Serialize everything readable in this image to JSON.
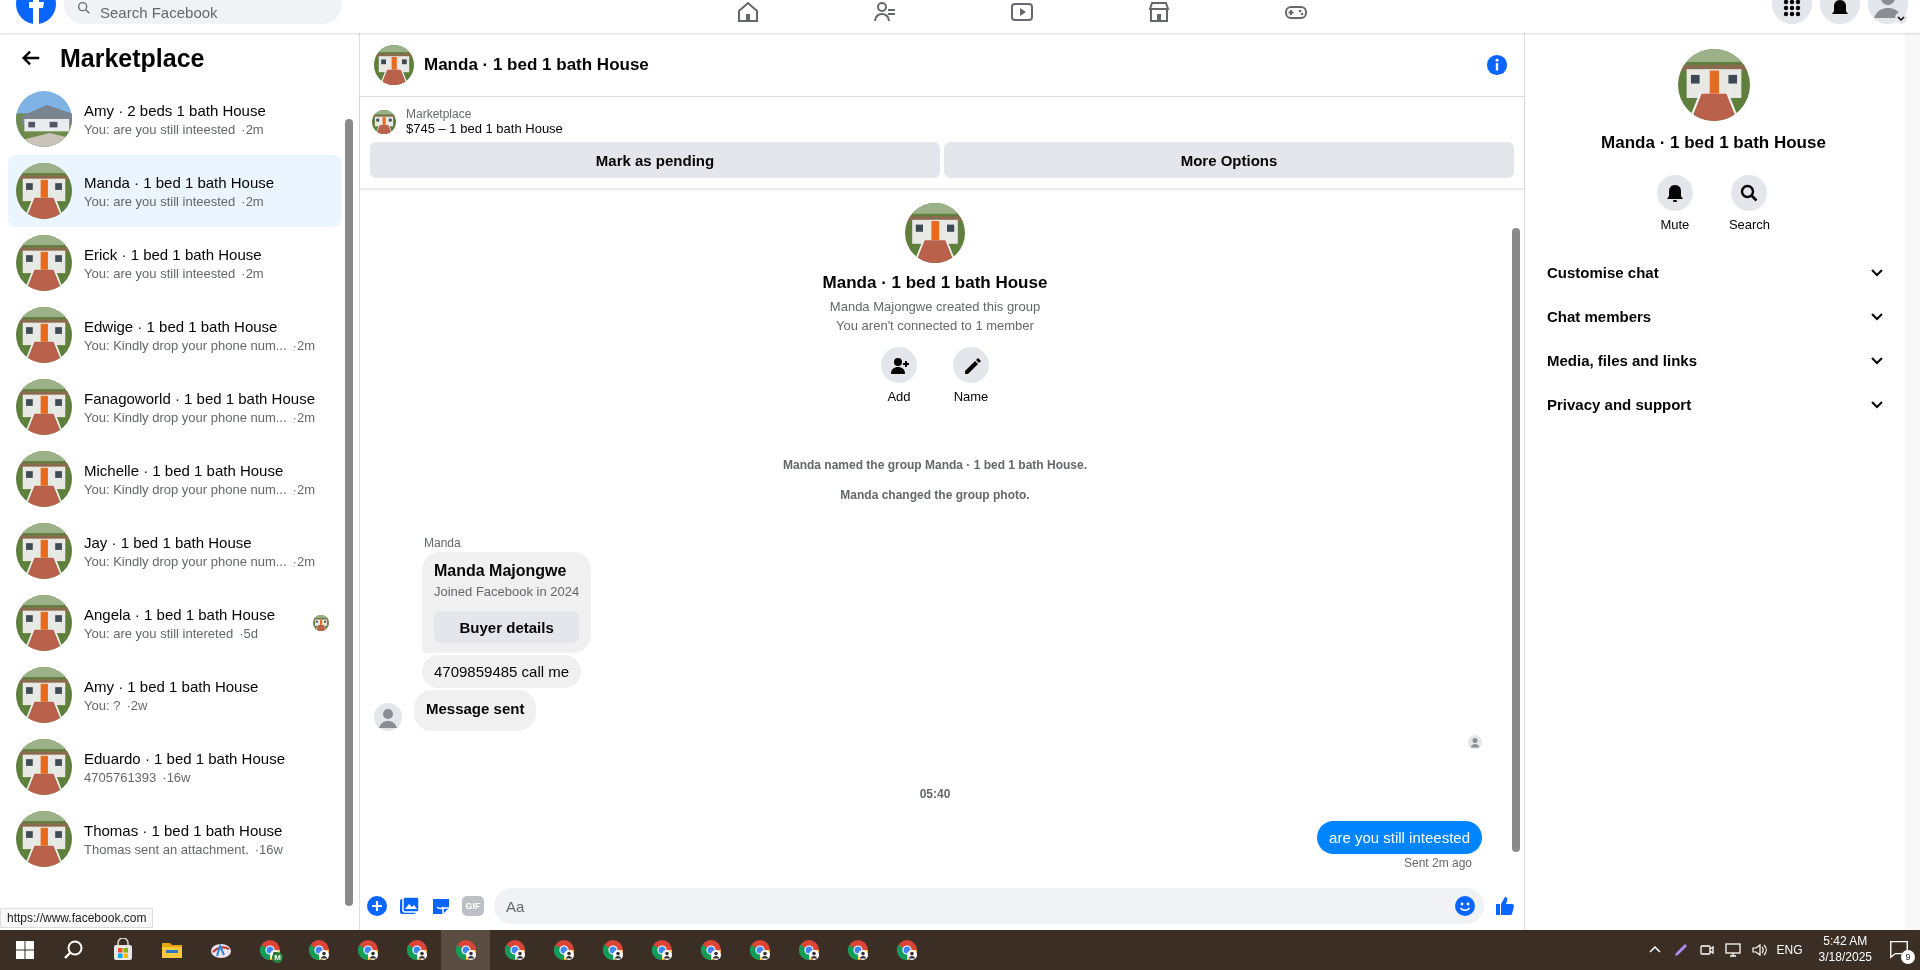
{
  "top_bar": {
    "search": {
      "placeholder": "Search Facebook"
    }
  },
  "sidebar": {
    "title": "Marketplace",
    "conversations": [
      {
        "title": "Amy · 2 beds 1 bath House",
        "preview": "You: are you still inteested",
        "time": "·2m",
        "selected": false,
        "seen": false
      },
      {
        "title": "Manda · 1 bed 1 bath House",
        "preview": "You: are you still inteested",
        "time": "·2m",
        "selected": true,
        "seen": false
      },
      {
        "title": "Erick · 1 bed 1 bath House",
        "preview": "You: are you still inteested",
        "time": "·2m",
        "selected": false,
        "seen": false
      },
      {
        "title": "Edwige · 1 bed 1 bath House",
        "preview": "You: Kindly drop your phone num...",
        "time": "·2m",
        "selected": false,
        "seen": false
      },
      {
        "title": "Fanagoworld · 1 bed 1 bath House",
        "preview": "You: Kindly drop your phone num...",
        "time": "·2m",
        "selected": false,
        "seen": false
      },
      {
        "title": "Michelle · 1 bed 1 bath House",
        "preview": "You: Kindly drop your phone num...",
        "time": "·2m",
        "selected": false,
        "seen": false
      },
      {
        "title": "Jay · 1 bed 1 bath House",
        "preview": "You: Kindly drop your phone num...",
        "time": "·2m",
        "selected": false,
        "seen": false
      },
      {
        "title": "Angela · 1 bed 1 bath House",
        "preview": "You: are you still intereted",
        "time": "·5d",
        "selected": false,
        "seen": true
      },
      {
        "title": "Amy · 1 bed 1 bath House",
        "preview": "You: ?",
        "time": "·2w",
        "selected": false,
        "seen": false
      },
      {
        "title": "Eduardo · 1 bed 1 bath House",
        "preview": "4705761393",
        "time": "·16w",
        "selected": false,
        "seen": false
      },
      {
        "title": "Thomas · 1 bed 1 bath House",
        "preview": "Thomas sent an attachment.",
        "time": "·16w",
        "selected": false,
        "seen": false
      }
    ]
  },
  "chat": {
    "title": "Manda · 1 bed 1 bath House",
    "listing": {
      "label": "Marketplace",
      "title": "$745 – 1 bed 1 bath House"
    },
    "actions": [
      "Mark as pending",
      "More Options"
    ],
    "intro": {
      "title": "Manda · 1 bed 1 bath House",
      "lines": [
        "Manda Majongwe created this group",
        "You aren't connected to 1 member"
      ],
      "buttons": [
        {
          "kind": "add",
          "label": "Add"
        },
        {
          "kind": "name",
          "label": "Name"
        }
      ]
    },
    "events": [
      "Manda named the group Manda · 1 bed 1 bath House.",
      "Manda changed the group photo."
    ],
    "sender": "Manda",
    "buyer_card": {
      "name": "Manda Majongwe",
      "subtitle": "Joined Facebook in 2024",
      "button": "Buyer details"
    },
    "messages": [
      {
        "text": "4709859485 call me",
        "bold": false
      },
      {
        "text": "Message sent",
        "bold": true
      }
    ],
    "timestamp": "05:40",
    "outgoing": {
      "text": "are you still inteested",
      "status": "Sent 2m ago"
    },
    "composer": {
      "gif_label": "GIF",
      "placeholder": "Aa"
    }
  },
  "details": {
    "title": "Manda · 1 bed 1 bath House",
    "actions": [
      {
        "kind": "mute",
        "label": "Mute"
      },
      {
        "kind": "search",
        "label": "Search"
      }
    ],
    "sections": [
      "Customise chat",
      "Chat members",
      "Media, files and links",
      "Privacy and support"
    ]
  },
  "status_url": "https://www.facebook.com",
  "taskbar": {
    "apps": [
      {
        "kind": "store",
        "active": false
      },
      {
        "kind": "files",
        "active": false
      },
      {
        "kind": "app",
        "active": false
      },
      {
        "kind": "browser",
        "active": false,
        "badge": "M"
      },
      {
        "kind": "browser",
        "active": false
      },
      {
        "kind": "browser",
        "active": false
      },
      {
        "kind": "browser",
        "active": false
      },
      {
        "kind": "browser",
        "active": true
      },
      {
        "kind": "browser",
        "active": false
      },
      {
        "kind": "browser",
        "active": false
      },
      {
        "kind": "browser",
        "active": false
      },
      {
        "kind": "browser",
        "active": false
      },
      {
        "kind": "browser",
        "active": false
      },
      {
        "kind": "browser",
        "active": false
      },
      {
        "kind": "browser",
        "active": false
      },
      {
        "kind": "browser",
        "active": false
      },
      {
        "kind": "browser",
        "active": false
      }
    ],
    "language": "ENG",
    "time": "5:42 AM",
    "date": "3/18/2025",
    "notifications": "9"
  }
}
